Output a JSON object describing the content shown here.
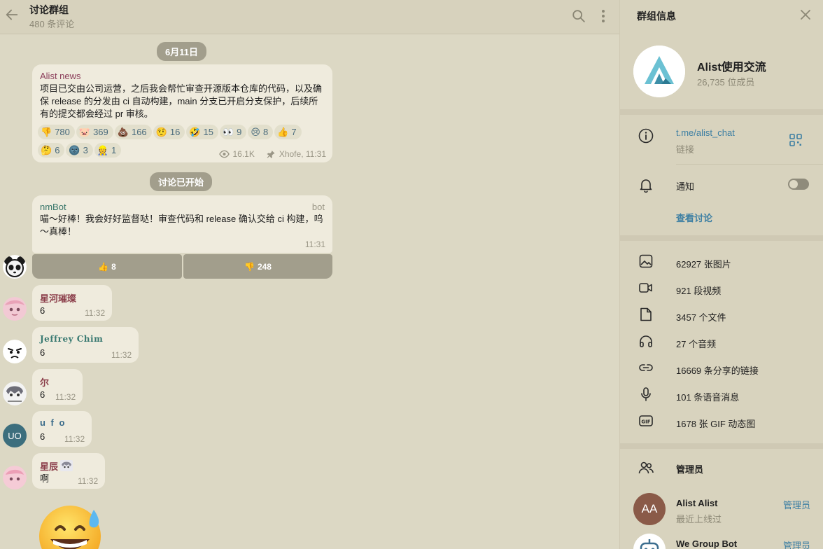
{
  "chat": {
    "title": "讨论群组",
    "subtitle": "480 条评论",
    "date_pill": "6月11日",
    "discussion_started": "讨论已开始",
    "post": {
      "sender": "Alist news",
      "text": "项目已交由公司运营，之后我会帮忙审查开源版本仓库的代码，以及确保 release 的分发由 ci 自动构建，main 分支已开启分支保护，后续所有的提交都会经过 pr 审核。",
      "reactions": [
        {
          "emoji": "👎",
          "count": "780"
        },
        {
          "emoji": "🐷",
          "count": "369"
        },
        {
          "emoji": "💩",
          "count": "166"
        },
        {
          "emoji": "🤨",
          "count": "16"
        },
        {
          "emoji": "🤣",
          "count": "15"
        },
        {
          "emoji": "👀",
          "count": "9"
        },
        {
          "emoji": "😢",
          "count": "8"
        },
        {
          "emoji": "👍",
          "count": "7"
        },
        {
          "emoji": "🤔",
          "count": "6"
        },
        {
          "emoji": "🌚",
          "count": "3"
        },
        {
          "emoji": "👷",
          "count": "1"
        }
      ],
      "views": "16.1K",
      "author_time": "Xhofe, 11:31"
    },
    "bot_message": {
      "sender": "nmBot",
      "tag": "bot",
      "text": "喵～好棒！我会好好监督哒！审查代码和 release 确认交给 ci 构建，呜～真棒！",
      "time": "11:31",
      "buttons": [
        {
          "emoji": "👍",
          "label": "8"
        },
        {
          "emoji": "👎",
          "label": "248"
        }
      ]
    },
    "messages": [
      {
        "sender": "星河璀璨",
        "text": "6",
        "time": "11:32",
        "color": "#8b3e4a"
      },
      {
        "sender": "Jeffrey Chim",
        "text": "6",
        "time": "11:32",
        "color": "#3a7a72"
      },
      {
        "sender": "尔",
        "text": "6",
        "time": "11:32",
        "color": "#8b3e4a"
      },
      {
        "sender": "u f o",
        "text": "6",
        "time": "11:32",
        "color": "#3a6b8a",
        "avatar_initials": "UO"
      },
      {
        "sender": "星辰",
        "text": "啊",
        "time": "11:32",
        "color": "#8b3e4a"
      }
    ],
    "sticker_emoji": "😅"
  },
  "info": {
    "title": "群组信息",
    "group_name": "Alist使用交流",
    "members": "26,735 位成员",
    "link": "t.me/alist_chat",
    "link_label": "链接",
    "notify_label": "通知",
    "view_discussion": "查看讨论",
    "media": [
      {
        "icon": "image-icon",
        "label": "62927 张图片"
      },
      {
        "icon": "video-icon",
        "label": "921 段视频"
      },
      {
        "icon": "file-icon",
        "label": "3457 个文件"
      },
      {
        "icon": "headphones-icon",
        "label": "27 个音频"
      },
      {
        "icon": "link-icon",
        "label": "16669 条分享的链接"
      },
      {
        "icon": "microphone-icon",
        "label": "101 条语音消息"
      },
      {
        "icon": "gif-icon",
        "label": "1678 张 GIF 动态图"
      }
    ],
    "admins_title": "管理员",
    "admins": [
      {
        "initials": "AA",
        "name": "Alist Alist",
        "status": "最近上线过",
        "role": "管理员"
      },
      {
        "name": "We Group Bot",
        "role": "管理员"
      }
    ]
  },
  "colors": {
    "accent": "#3d7fa3",
    "panel_bg": "#d8d3be",
    "chat_bg": "#dcd8c4",
    "bubble_bg": "#efebdd"
  }
}
